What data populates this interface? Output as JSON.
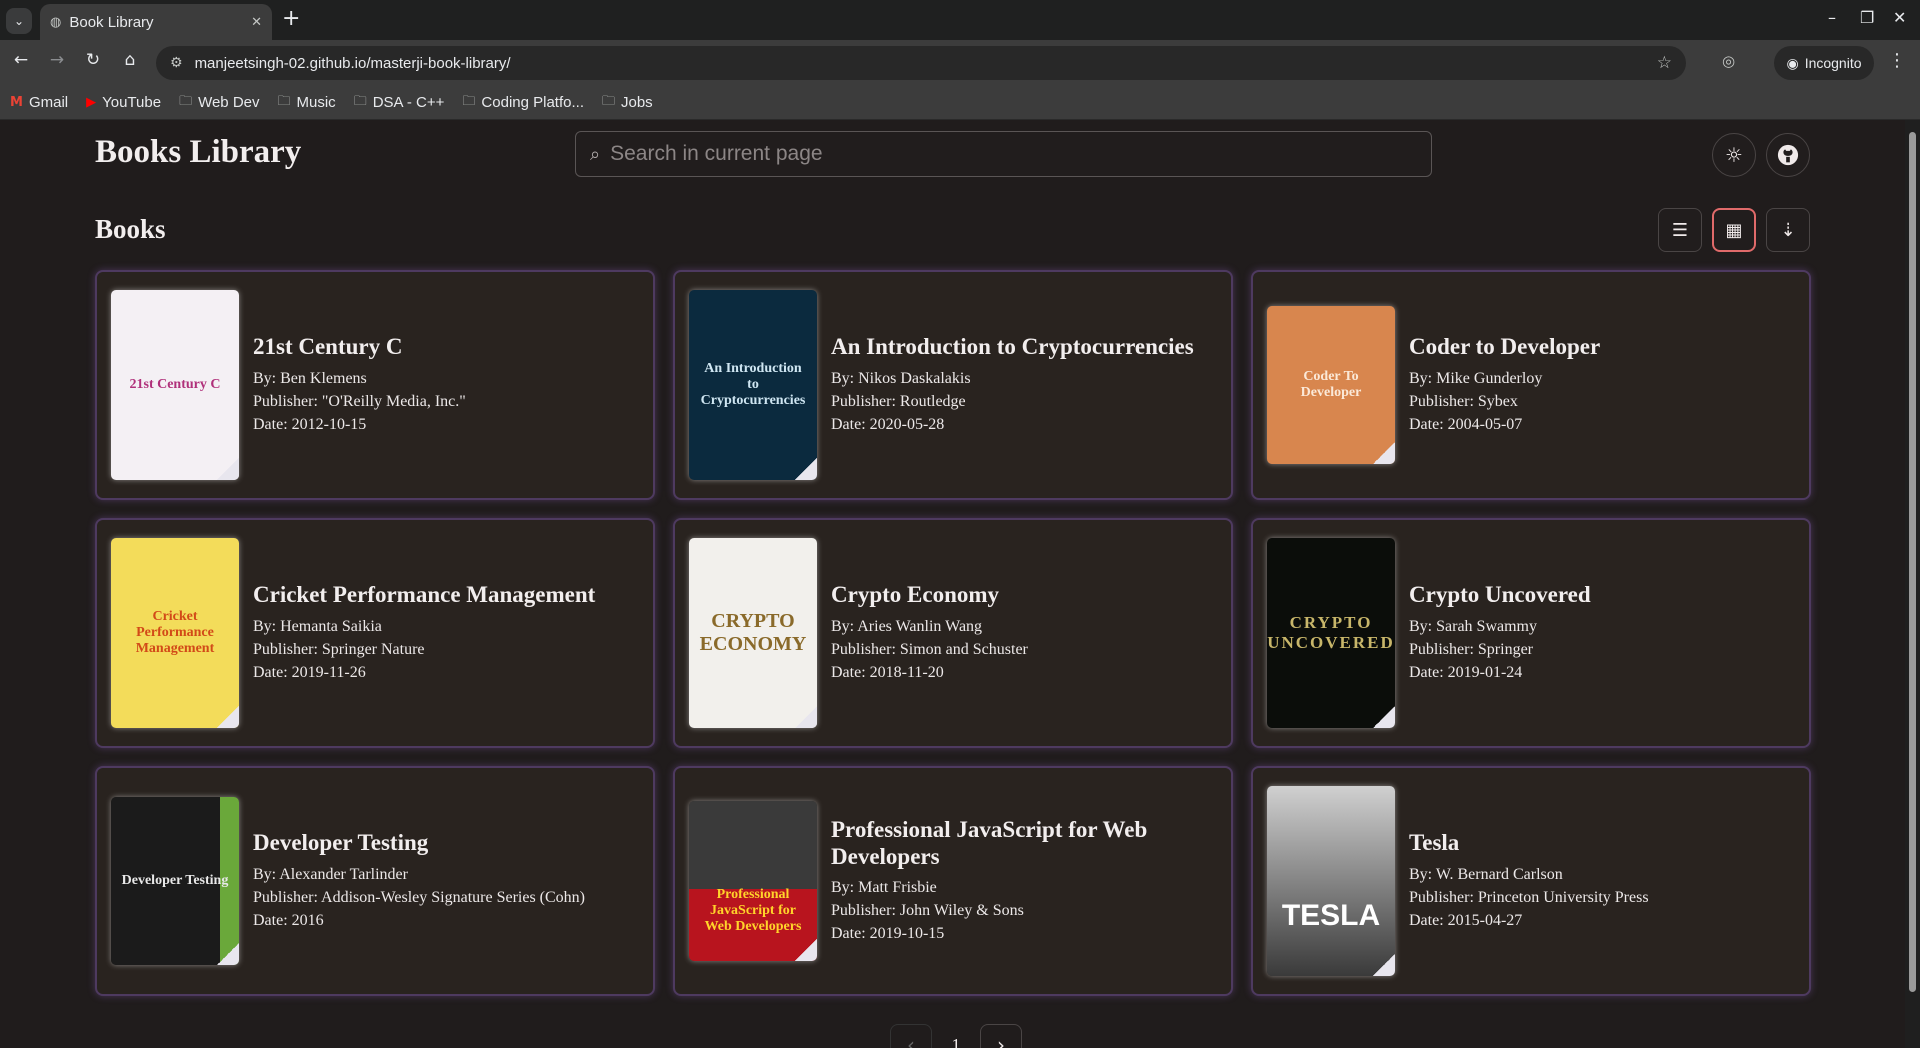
{
  "browser": {
    "tab_title": "Book Library",
    "url": "manjeetsingh-02.github.io/masterji-book-library/",
    "incognito_label": "Incognito",
    "bookmarks": [
      {
        "label": "Gmail",
        "icon": "gmail-icon"
      },
      {
        "label": "YouTube",
        "icon": "youtube-icon"
      },
      {
        "label": "Web Dev",
        "icon": "folder-icon"
      },
      {
        "label": "Music",
        "icon": "folder-icon"
      },
      {
        "label": "DSA - C++",
        "icon": "folder-icon"
      },
      {
        "label": "Coding Platfo...",
        "icon": "folder-icon"
      },
      {
        "label": "Jobs",
        "icon": "folder-icon"
      }
    ]
  },
  "header": {
    "title": "Books Library",
    "search_placeholder": "Search in current page"
  },
  "section": {
    "title": "Books"
  },
  "books": [
    {
      "title": "21st Century C",
      "author": "By: Ben Klemens",
      "publisher": "Publisher: \"O'Reilly Media, Inc.\"",
      "date": "Date: 2012-10-15",
      "cover_text": "21st Century C",
      "cover_bg": "#f4f0f4",
      "cover_fg": "#b0307a"
    },
    {
      "title": "An Introduction to Cryptocurrencies",
      "author": "By: Nikos Daskalakis",
      "publisher": "Publisher: Routledge",
      "date": "Date: 2020-05-28",
      "cover_text": "An Introduction to Cryptocurrencies",
      "cover_bg": "#0b2a3e",
      "cover_fg": "#cfe6f2"
    },
    {
      "title": "Coder to Developer",
      "author": "By: Mike Gunderloy",
      "publisher": "Publisher: Sybex",
      "date": "Date: 2004-05-07",
      "cover_text": "Coder To Developer",
      "cover_bg": "#d8864e",
      "cover_fg": "#fbe9d8"
    },
    {
      "title": "Cricket Performance Management",
      "author": "By: Hemanta Saikia",
      "publisher": "Publisher: Springer Nature",
      "date": "Date: 2019-11-26",
      "cover_text": "Cricket Performance Management",
      "cover_bg": "#f3dc5a",
      "cover_fg": "#d24a18"
    },
    {
      "title": "Crypto Economy",
      "author": "By: Aries Wanlin Wang",
      "publisher": "Publisher: Simon and Schuster",
      "date": "Date: 2018-11-20",
      "cover_text": "CRYPTO ECONOMY",
      "cover_bg": "#f2f0ec",
      "cover_fg": "#8a6a2a"
    },
    {
      "title": "Crypto Uncovered",
      "author": "By: Sarah Swammy",
      "publisher": "Publisher: Springer",
      "date": "Date: 2019-01-24",
      "cover_text": "CRYPTO UNCOVERED",
      "cover_bg": "#0b0d0a",
      "cover_fg": "#c8b66a"
    },
    {
      "title": "Developer Testing",
      "author": "By: Alexander Tarlinder",
      "publisher": "Publisher: Addison-Wesley Signature Series (Cohn)",
      "date": "Date: 2016",
      "cover_text": "Developer Testing",
      "cover_bg": "#1b1b1b",
      "cover_fg": "#e8e8e8"
    },
    {
      "title": "Professional JavaScript for Web Developers",
      "author": "By: Matt Frisbie",
      "publisher": "Publisher: John Wiley & Sons",
      "date": "Date: 2019-10-15",
      "cover_text": "Professional JavaScript for Web Developers",
      "cover_bg": "#b8141e",
      "cover_fg": "#ffd42a"
    },
    {
      "title": "Tesla",
      "author": "By: W. Bernard Carlson",
      "publisher": "Publisher: Princeton University Press",
      "date": "Date: 2015-04-27",
      "cover_text": "TESLA",
      "cover_bg": "#5a5a5a",
      "cover_fg": "#ffffff"
    }
  ],
  "pagination": {
    "current_page": "1"
  }
}
